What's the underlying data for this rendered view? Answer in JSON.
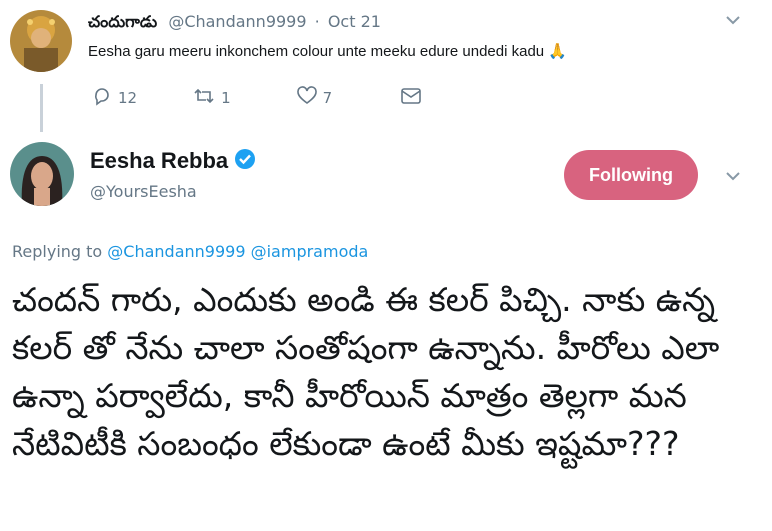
{
  "reply_tweet": {
    "display_name": "చందుగాడు",
    "handle": "@Chandann9999",
    "separator": "·",
    "date": "Oct 21",
    "text": "Eesha garu meeru inkonchem colour unte meeku edure undedi kadu",
    "emoji": "🙏",
    "actions": {
      "replies": "12",
      "retweets": "1",
      "likes": "7"
    },
    "icons": [
      "reply-icon",
      "retweet-icon",
      "like-icon",
      "dm-icon",
      "chevron-down-icon"
    ]
  },
  "main_tweet": {
    "display_name": "Eesha Rebba",
    "handle": "@YoursEesha",
    "verified": true,
    "follow_button": "Following",
    "replying_prefix": "Replying to",
    "replying_to": [
      "@Chandann9999",
      "@iampramoda"
    ],
    "text": "చందన్ గారు, ఎందుకు అండి ఈ కలర్ పిచ్చి. నాకు ఉన్న కలర్ తో నేను చాలా సంతోషంగా ఉన్నాను. హీరోలు ఎలా ఉన్నా పర్వాలేదు, కానీ హీరోయిన్ మాత్రం తెల్లగా మన నేటివిటీకి సంబంధం లేకుండా ఉంటే మీకు ఇష్టమా???"
  },
  "colors": {
    "accent": "#1da1f2",
    "follow_button": "#d8637f",
    "muted": "#657786"
  }
}
